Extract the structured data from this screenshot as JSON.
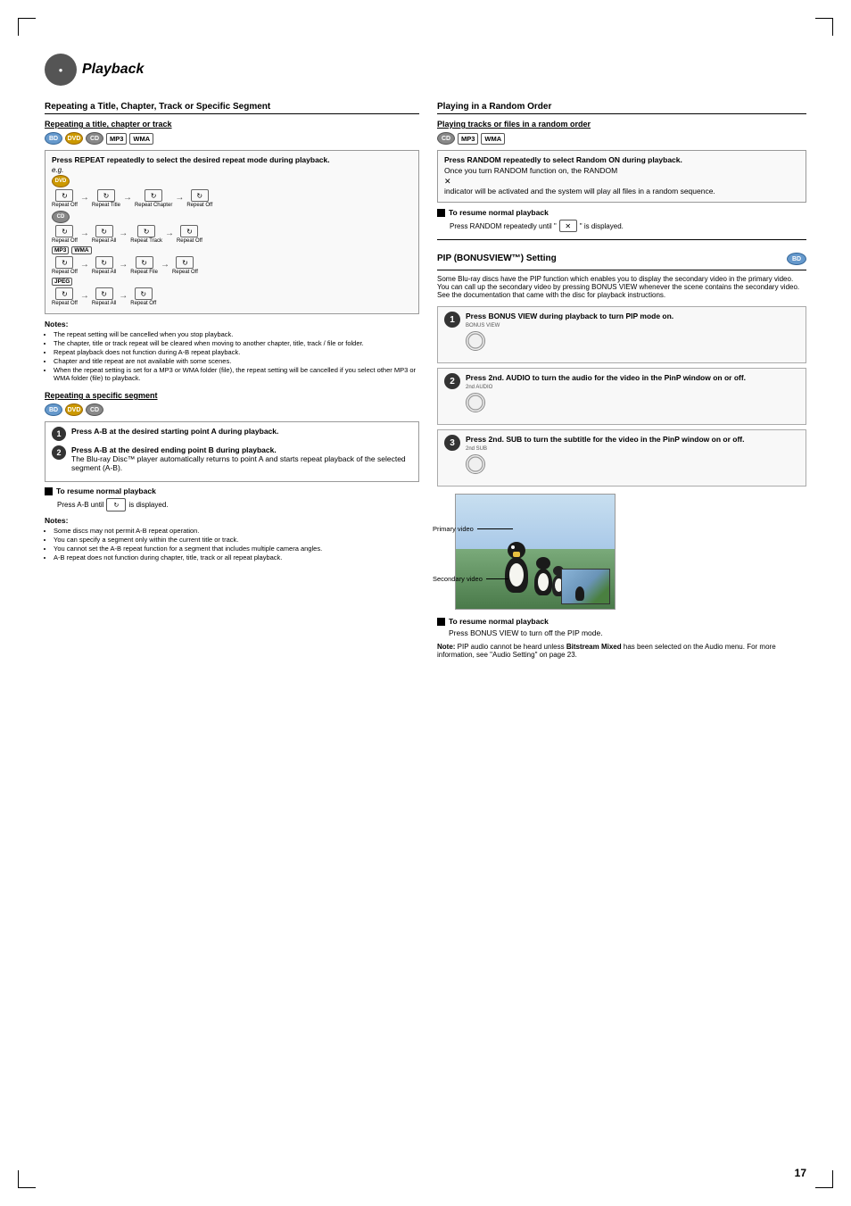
{
  "page": {
    "number": "17",
    "title": "Playback",
    "title_icon": "disc"
  },
  "left_col": {
    "section1": {
      "heading": "Repeating a Title, Chapter, Track or Specific Segment",
      "sub1": {
        "label": "Repeating a title, chapter or track",
        "badges": [
          "BD",
          "DVD",
          "CD",
          "MP3",
          "WMA"
        ],
        "instr_box": {
          "text": "Press REPEAT repeatedly to select the desired repeat mode during playback."
        },
        "eg": "e.g.",
        "dvd_seq": [
          "Repeat Off",
          "Repeat Title",
          "Repeat Chapter",
          "Repeat Off"
        ],
        "cd_seq": [
          "Repeat Off",
          "Repeat All",
          "Repeat Track",
          "Repeat Off"
        ],
        "mp3wma_seq": [
          "Repeat Off",
          "Repeat All",
          "Repeat File",
          "Repeat Off"
        ],
        "jpeg_seq": [
          "Repeat Off",
          "Repeat All",
          "Repeat Off"
        ]
      },
      "notes": {
        "title": "Notes:",
        "items": [
          "The repeat setting will be cancelled when you stop playback.",
          "The chapter, title or track repeat will be cleared when moving to another chapter, title, track / file or folder.",
          "Repeat playback does not function during A-B repeat playback.",
          "Chapter and title repeat are not available with some scenes.",
          "When the repeat setting is set for a MP3 or WMA folder (file), the repeat setting will be cancelled if you select other MP3 or WMA folder (file) to playback."
        ]
      }
    },
    "sub2": {
      "label": "Repeating a specific segment",
      "badges": [
        "BD",
        "DVD",
        "CD"
      ],
      "step1": "Press A-B at the desired starting point A during playback.",
      "step2": "Press A-B at the desired ending point B during playback.",
      "step2_detail": "The Blu-ray Disc™ player automatically returns to point A and starts repeat playback of the selected segment (A-B).",
      "resume_heading": "To resume normal playback",
      "resume_text": "Press A-B until",
      "resume_suffix": "is displayed.",
      "notes2": {
        "title": "Notes:",
        "items": [
          "Some discs may not permit A-B repeat operation.",
          "You can specify a segment only within the current title or track.",
          "You cannot set the A-B repeat function for a segment that includes multiple camera angles.",
          "A-B repeat does not function during chapter, title, track or all repeat playback."
        ]
      }
    }
  },
  "right_col": {
    "section_random": {
      "heading": "Playing in a Random Order",
      "sub_label": "Playing tracks or files in a random order",
      "badges": [
        "CD",
        "MP3",
        "WMA"
      ],
      "instr_box": {
        "line1": "Press RANDOM repeatedly to select Random ON during playback.",
        "line2": "Once you turn RANDOM function on, the RANDOM",
        "line3": "indicator will be activated and the system will play all files in a random sequence."
      },
      "resume_heading": "To resume normal playback",
      "resume_text": "Press RANDOM repeatedly until \"",
      "resume_icon_label": "Random Off",
      "resume_suffix": "\" is displayed."
    },
    "section_pip": {
      "heading": "PIP (BONUSVIEW™) Setting",
      "badge": "BD",
      "intro": "Some Blu-ray discs have the PIP function which enables you to display the secondary video in the primary video. You can call up the secondary video by pressing BONUS VIEW whenever the scene contains the secondary video. See the documentation that came with the disc for playback instructions.",
      "steps": [
        {
          "num": "1",
          "bold": "Press BONUS VIEW during playback to turn PIP mode on.",
          "button_label": "BONUS VIEW",
          "button_shape": "circle"
        },
        {
          "num": "2",
          "bold": "Press 2nd. AUDIO to turn the audio for the video in the PinP window on or off.",
          "button_label": "2nd AUDIO",
          "button_shape": "circle"
        },
        {
          "num": "3",
          "bold": "Press 2nd. SUB to turn the subtitle for the video in the PinP window on or off.",
          "button_label": "2nd SUB",
          "button_shape": "circle"
        }
      ],
      "primary_label": "Primary video",
      "secondary_label": "Secondary video",
      "resume_heading": "To resume normal playback",
      "resume_text": "Press BONUS VIEW to turn off the PIP mode.",
      "note": {
        "text": "Note: PIP audio cannot be heard unless Bitstream Mixed has been selected on the Audio menu. For more information, see \"Audio Setting\" on page 23."
      }
    }
  }
}
